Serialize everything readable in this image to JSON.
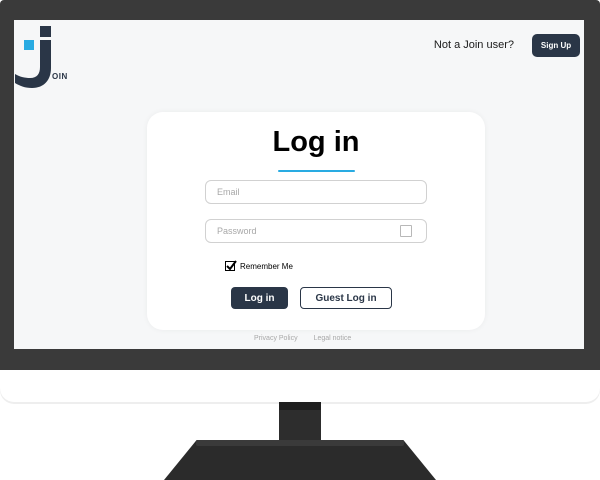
{
  "brand": {
    "logo_text": "OIN",
    "primary_color": "#2a3647",
    "accent_color": "#29abe2"
  },
  "header": {
    "prompt": "Not a Join user?",
    "signup_label": "Sign Up"
  },
  "login": {
    "title": "Log in",
    "email_placeholder": "Email",
    "password_placeholder": "Password",
    "remember_label": "Remember Me",
    "remember_checked": true,
    "login_label": "Log in",
    "guest_label": "Guest Log in"
  },
  "footer": {
    "privacy": "Privacy Policy",
    "legal": "Legal notice"
  },
  "icons": {
    "logo": "join-logo-icon",
    "password": "lock-icon",
    "checkbox": "checkmark-icon"
  }
}
